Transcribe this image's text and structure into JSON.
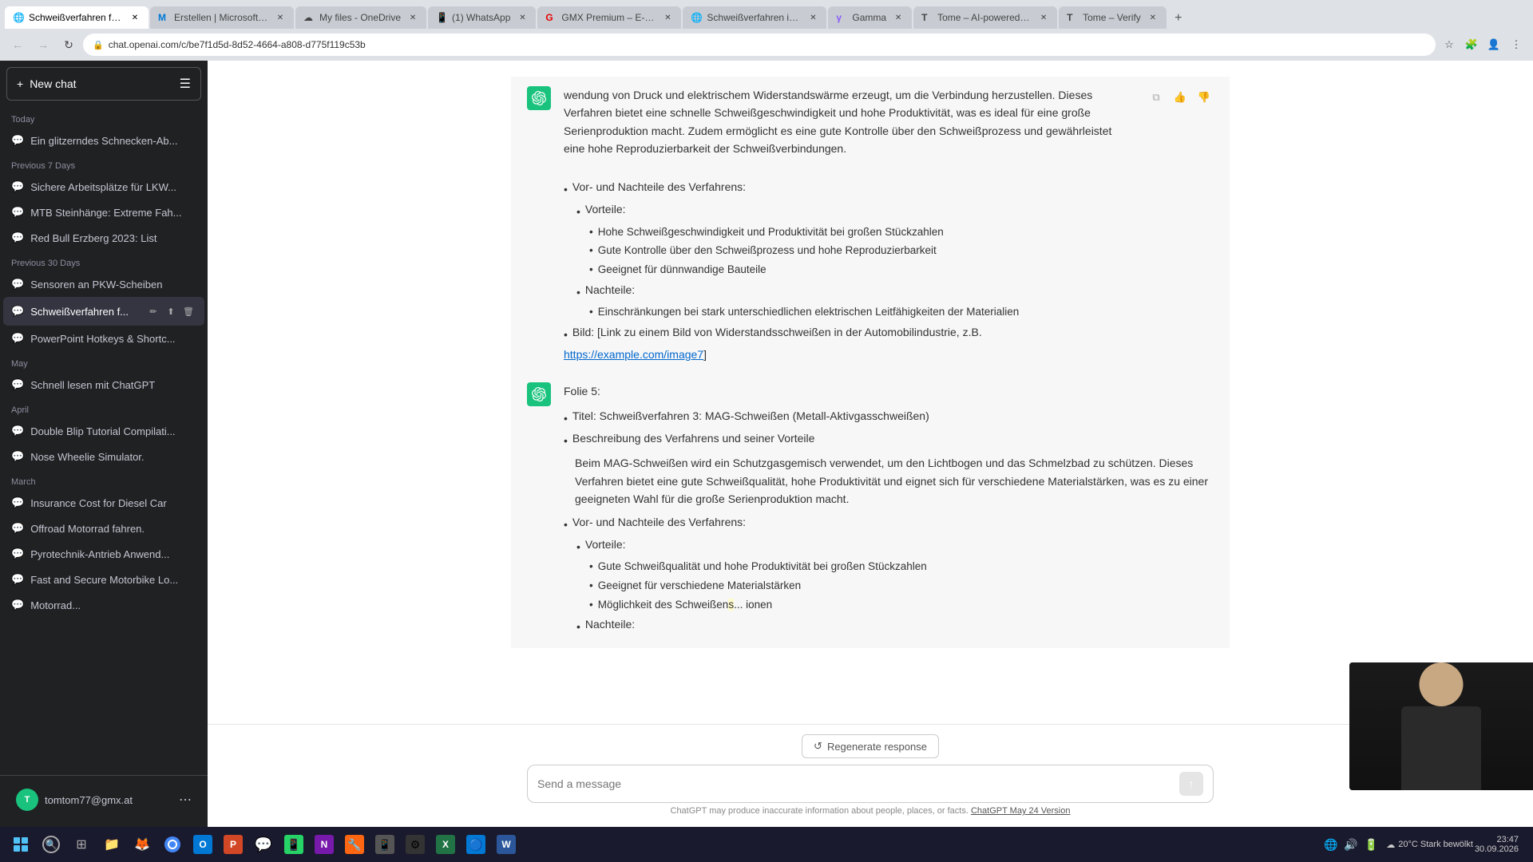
{
  "browser": {
    "tabs": [
      {
        "id": "tab1",
        "title": "Schweißverfahren fü...",
        "favicon_color": "#4285f4",
        "active": true,
        "favicon": "🌐"
      },
      {
        "id": "tab2",
        "title": "Erstellen | Microsoft 3...",
        "favicon_color": "#0078d4",
        "active": false,
        "favicon": "M"
      },
      {
        "id": "tab3",
        "title": "My files - OneDrive",
        "favicon_color": "#0078d4",
        "active": false,
        "favicon": "☁"
      },
      {
        "id": "tab4",
        "title": "(1) WhatsApp",
        "favicon_color": "#25d366",
        "active": false,
        "favicon": "📱"
      },
      {
        "id": "tab5",
        "title": "GMX Premium – E-Ma...",
        "favicon_color": "#e60000",
        "active": false,
        "favicon": "G"
      },
      {
        "id": "tab6",
        "title": "Schweißverfahren in ...",
        "favicon_color": "#4285f4",
        "active": false,
        "favicon": "🌐"
      },
      {
        "id": "tab7",
        "title": "Gamma",
        "favicon_color": "#8b5cf6",
        "active": false,
        "favicon": "γ"
      },
      {
        "id": "tab8",
        "title": "Tome – AI-powered s...",
        "favicon_color": "#333",
        "active": false,
        "favicon": "T"
      },
      {
        "id": "tab9",
        "title": "Tome – Verify",
        "favicon_color": "#333",
        "active": false,
        "favicon": "T"
      }
    ],
    "address": "chat.openai.com/c/be7f1d5d-8d52-4664-a808-d775f119c53b"
  },
  "sidebar": {
    "new_chat_label": "New chat",
    "sections": [
      {
        "label": "Today",
        "items": [
          {
            "id": "item1",
            "text": "Ein glitzerndes Schnecken-Ab...",
            "active": false
          }
        ]
      },
      {
        "label": "Previous 7 Days",
        "items": [
          {
            "id": "item2",
            "text": "Sichere Arbeitsplätze für LKW...",
            "active": false
          },
          {
            "id": "item3",
            "text": "MTB Steinhänge: Extreme Fah...",
            "active": false
          },
          {
            "id": "item4",
            "text": "Red Bull Erzberg 2023: List",
            "active": false
          }
        ]
      },
      {
        "label": "Previous 30 Days",
        "items": [
          {
            "id": "item5",
            "text": "Sensoren an PKW-Scheiben",
            "active": false
          },
          {
            "id": "item6",
            "text": "Schweißverfahren f...",
            "active": true
          },
          {
            "id": "item7",
            "text": "PowerPoint Hotkeys & Shortc...",
            "active": false
          }
        ]
      },
      {
        "label": "May",
        "items": [
          {
            "id": "item8",
            "text": "Schnell lesen mit ChatGPT",
            "active": false
          }
        ]
      },
      {
        "label": "April",
        "items": [
          {
            "id": "item9",
            "text": "Double Blip Tutorial Compilati...",
            "active": false
          },
          {
            "id": "item10",
            "text": "Nose Wheelie Simulator.",
            "active": false
          }
        ]
      },
      {
        "label": "March",
        "items": [
          {
            "id": "item11",
            "text": "Insurance Cost for Diesel Car",
            "active": false
          },
          {
            "id": "item12",
            "text": "Offroad Motorrad fahren.",
            "active": false
          },
          {
            "id": "item13",
            "text": "Pyrotechnik-Antrieb Anwend...",
            "active": false
          },
          {
            "id": "item14",
            "text": "Fast and Secure Motorbike Lo...",
            "active": false
          },
          {
            "id": "item15",
            "text": "Motorrad...",
            "active": false
          }
        ]
      }
    ],
    "user_email": "tomtom77@gmx.at",
    "user_initials": "T"
  },
  "chat": {
    "messages": [
      {
        "role": "assistant",
        "content_blocks": [
          {
            "type": "text",
            "text": "wendung von Druck und elektrischem Widerstandswärme erzeugt, um die Verbindung herzustellen. Dieses Verfahren bietet eine schnelle Schweißgeschwindigkeit und hohe Produktivität, was es ideal für eine große Serienproduktion macht. Zudem ermöglicht es eine gute Kontrolle über den Schweißprozess und gewährleistet eine hohe Reproduzierbarkeit der Schweißverbindungen."
          },
          {
            "type": "bullet",
            "text": "Vor- und Nachteile des Verfahrens:"
          },
          {
            "type": "sub_section",
            "label": "Vorteile:",
            "items": [
              "Hohe Schweißgeschwindigkeit und Produktivität bei großen Stückzahlen",
              "Gute Kontrolle über den Schweißprozess und hohe Reproduzierbarkeit",
              "Geeignet für dünnwandige Bauteile"
            ]
          },
          {
            "type": "sub_section",
            "label": "Nachteile:",
            "items": [
              "Einschränkungen bei stark unterschiedlichen elektrischen Leitfähigkeiten der Materialien"
            ]
          },
          {
            "type": "bullet",
            "text": "Bild: [Link zu einem Bild von Widerstandsschweißen in der Automobilindustrie, z.B."
          },
          {
            "type": "link",
            "text": "https://example.com/image7"
          },
          {
            "type": "text",
            "text": "]"
          }
        ]
      },
      {
        "role": "assistant",
        "folie": "Folie 5:",
        "content_blocks": [
          {
            "type": "bullet",
            "text": "Titel: Schweißverfahren 3: MAG-Schweißen (Metall-Aktivgasschweißen)"
          },
          {
            "type": "bullet",
            "text": "Beschreibung des Verfahrens und seiner Vorteile"
          },
          {
            "type": "text",
            "text": "Beim MAG-Schweißen wird ein Schutzgasgemisch verwendet, um den Lichtbogen und das Schmelzbad zu schützen. Dieses Verfahren bietet eine gute Schweißqualität, hohe Produktivität und eignet sich für verschiedene Materialstärken, was es zu einer geeigneten Wahl für die große Serienproduktion macht."
          },
          {
            "type": "bullet",
            "text": "Vor- und Nachteile des Verfahrens:"
          },
          {
            "type": "sub_section",
            "label": "Vorteile:",
            "items": [
              "Gute Schweißqualität und hohe Produktivität bei großen Stückzahlen",
              "Geeignet für verschiedene Materialstärken",
              "Möglichkeit des Schweißen... ionen"
            ]
          },
          {
            "type": "bullet",
            "text": "Nachteile:"
          }
        ]
      }
    ]
  },
  "input": {
    "placeholder": "Send a message",
    "value": ""
  },
  "regenerate": {
    "label": "Regenerate response"
  },
  "disclaimer": {
    "text": "ChatGPT may produce inaccurate information about people, places, or facts.",
    "link_text": "ChatGPT May 24 Version"
  },
  "taskbar": {
    "apps": [
      {
        "id": "start",
        "icon": "⊞",
        "type": "start"
      },
      {
        "id": "files",
        "icon": "📁",
        "color": "#ffc107"
      },
      {
        "id": "firefox",
        "icon": "🦊",
        "color": "#ff6611"
      },
      {
        "id": "chrome",
        "icon": "🌐",
        "color": "#4285f4"
      },
      {
        "id": "outlook",
        "icon": "📧",
        "color": "#0078d4"
      },
      {
        "id": "powerpoint",
        "icon": "P",
        "color": "#d24726"
      },
      {
        "id": "teams",
        "icon": "T",
        "color": "#6264a7"
      },
      {
        "id": "whatsapp",
        "icon": "💬",
        "color": "#25d366"
      },
      {
        "id": "onenote",
        "icon": "N",
        "color": "#7719aa"
      },
      {
        "id": "app1",
        "icon": "🔧",
        "color": "#555"
      },
      {
        "id": "app2",
        "icon": "📱",
        "color": "#888"
      },
      {
        "id": "app3",
        "icon": "⚙",
        "color": "#555"
      },
      {
        "id": "app4",
        "icon": "📊",
        "color": "#217346"
      },
      {
        "id": "app5",
        "icon": "🔵",
        "color": "#0078d4"
      },
      {
        "id": "word",
        "icon": "W",
        "color": "#2b579a"
      }
    ],
    "weather": "20°C  Stark bewölkt",
    "time": "current"
  },
  "icons": {
    "plus": "+",
    "pencil": "✏",
    "copy": "⧉",
    "trash": "🗑",
    "thumb_up": "👍",
    "thumb_down": "👎",
    "copy_msg": "⧉",
    "refresh": "↺",
    "send": "↑",
    "chat_icon": "✦",
    "sidebar_icon": "☰"
  }
}
